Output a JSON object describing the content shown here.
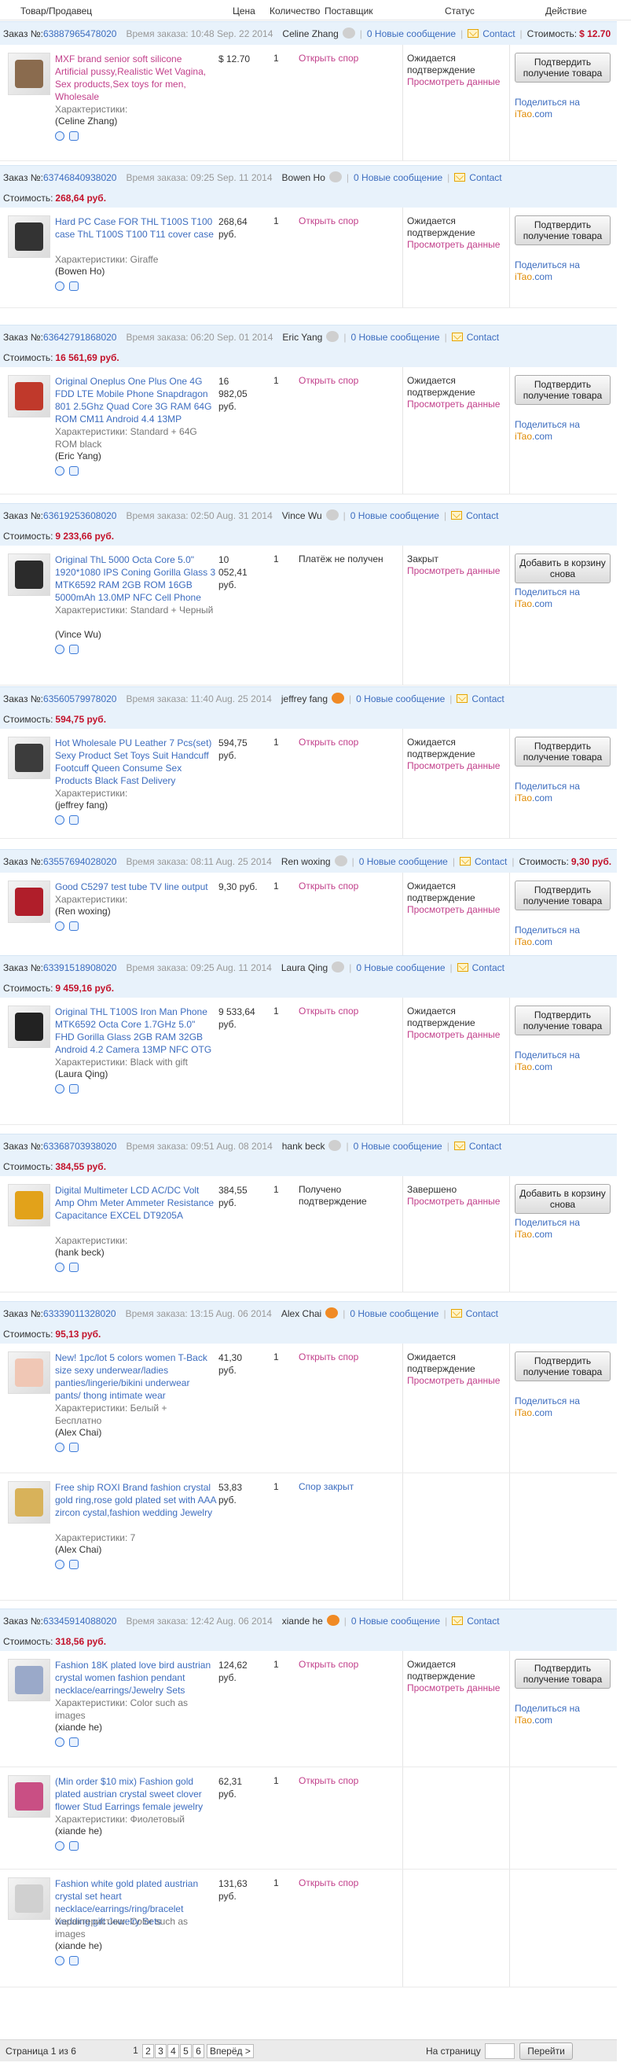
{
  "header": {
    "product_seller": "Товар/Продавец",
    "price": "Цена",
    "quantity": "Количество",
    "supplier": "Поставщик",
    "status": "Статус",
    "action": "Действие"
  },
  "labels": {
    "order_prefix": "Заказ №:",
    "order_time": "Время заказа:",
    "new_messages": "0 Новые сообщение",
    "contact": "Contact",
    "cost": "Стоимость:",
    "characteristics": "Характеристики:",
    "open_dispute": "Открыть спор",
    "share": "Поделиться на",
    "itao": "iTao",
    "itao_com": ".com"
  },
  "orders": [
    {
      "number": "63887965478020",
      "time": "10:48 Sep. 22 2014",
      "seller": "Celine Zhang",
      "cost": "$ 12.70",
      "items": [
        {
          "title": "MXF brand senior soft silicone Artificial pussy,Realistic Wet Vagina, Sex products,Sex toys for men, Wholesale",
          "characteristics": "Характеристики:",
          "seller": "(Celine Zhang)",
          "price": "$ 12.70",
          "qty": "1",
          "dispute": "Открыть спор",
          "status": "Ожидается подтверждение",
          "view": "Просмотреть данные",
          "button": "Подтвердить получение товара"
        }
      ]
    },
    {
      "number": "63746840938020",
      "time": "09:25 Sep. 11 2014",
      "seller": "Bowen Ho",
      "cost": "268,64 руб.",
      "items": [
        {
          "title": "Hard PC Case FOR THL T100S T100 case ThL T100S T100 T11 cover case",
          "characteristics": "Характеристики: Giraffe",
          "seller": "(Bowen Ho)",
          "price": "268,64 руб.",
          "qty": "1",
          "dispute": "Открыть спор",
          "status": "Ожидается подтверждение",
          "view": "Просмотреть данные",
          "button": "Подтвердить получение товара"
        }
      ]
    },
    {
      "number": "63642791868020",
      "time": "06:20 Sep. 01 2014",
      "seller": "Eric Yang",
      "cost": "16 561,69 руб.",
      "items": [
        {
          "title": "Original Oneplus One Plus One 4G FDD LTE Mobile Phone Snapdragon 801 2.5Ghz Quad Core 3G RAM 64G ROM CM11 Android 4.4 13MP",
          "characteristics": "Характеристики: Standard + 64G ROM black",
          "seller": "(Eric Yang)",
          "price": "16 982,05 руб.",
          "qty": "1",
          "dispute": "Открыть спор",
          "status": "Ожидается подтверждение",
          "view": "Просмотреть данные",
          "button": "Подтвердить получение товара"
        }
      ]
    },
    {
      "number": "63619253608020",
      "time": "02:50 Aug. 31 2014",
      "seller": "Vince Wu",
      "cost": "9 233,66 руб.",
      "items": [
        {
          "title": "Original ThL 5000 Octa Core 5.0\" 1920*1080 IPS Coning Gorilla Glass 3 MTK6592 RAM 2GB ROM 16GB 5000mAh 13.0MP NFC Cell Phone",
          "characteristics": "Характеристики: Standard + Черный",
          "seller": "(Vince Wu)",
          "price": "10 052,41 руб.",
          "qty": "1",
          "dispute": "Платёж не получен",
          "status": "Закрыт",
          "view": "Просмотреть данные",
          "button": "Добавить в корзину снова"
        }
      ]
    },
    {
      "number": "63560579978020",
      "time": "11:40 Aug. 25 2014",
      "seller": "jeffrey fang",
      "cost": "594,75 руб.",
      "items": [
        {
          "title": "Hot Wholesale PU Leather 7 Pcs(set) Sexy Product Set Toys Suit Handcuff Footcuff Queen Consume Sex Products Black Fast Delivery",
          "characteristics": "Характеристики:",
          "seller": "(jeffrey fang)",
          "price": "594,75 руб.",
          "qty": "1",
          "dispute": "Открыть спор",
          "status": "Ожидается подтверждение",
          "view": "Просмотреть данные",
          "button": "Подтвердить получение товара"
        }
      ]
    },
    {
      "number": "63557694028020",
      "time": "08:11 Aug. 25 2014",
      "seller": "Ren woxing",
      "cost": "9,30 руб.",
      "items": [
        {
          "title": "Good C5297 test tube TV line output",
          "characteristics": "Характеристики:",
          "seller": "(Ren woxing)",
          "price": "9,30 руб.",
          "qty": "1",
          "dispute": "Открыть спор",
          "status": "Ожидается подтверждение",
          "view": "Просмотреть данные",
          "button": "Подтвердить получение товара"
        }
      ]
    },
    {
      "number": "63391518908020",
      "time": "09:25 Aug. 11 2014",
      "seller": "Laura Qing",
      "cost": "9 459,16 руб.",
      "items": [
        {
          "title": "Original THL T100S Iron Man Phone MTK6592 Octa Core 1.7GHz 5.0\" FHD Gorilla Glass 2GB RAM 32GB Android 4.2 Camera 13MP NFC OTG",
          "characteristics": "Характеристики: Black with gift",
          "seller": "(Laura Qing)",
          "price": "9 533,64 руб.",
          "qty": "1",
          "dispute": "Открыть спор",
          "status": "Ожидается подтверждение",
          "view": "Просмотреть данные",
          "button": "Подтвердить получение товара"
        }
      ]
    },
    {
      "number": "63368703938020",
      "time": "09:51 Aug. 08 2014",
      "seller": "hank beck",
      "cost": "384,55 руб.",
      "items": [
        {
          "title": "Digital Multimeter LCD AC/DC Volt Amp Ohm Meter Ammeter Resistance Capacitance EXCEL DT9205A",
          "characteristics": "Характеристики:",
          "seller": "(hank beck)",
          "price": "384,55 руб.",
          "qty": "1",
          "dispute": "Получено подтверждение",
          "status": "Завершено",
          "view": "Просмотреть данные",
          "button": "Добавить в корзину снова"
        }
      ]
    },
    {
      "number": "63339011328020",
      "time": "13:15 Aug. 06 2014",
      "seller": "Alex Chai",
      "cost": "95,13 руб.",
      "items": [
        {
          "title": "New! 1pc/lot 5 colors women T-Back size sexy underwear/ladies panties/lingerie/bikini underwear pants/ thong intimate wear",
          "characteristics": "Характеристики: Белый + Бесплатно",
          "seller": "(Alex Chai)",
          "price": "41,30 руб.",
          "qty": "1",
          "dispute": "Открыть спор",
          "status": "Ожидается подтверждение",
          "view": "Просмотреть данные",
          "button": "Подтвердить получение товара"
        },
        {
          "title": "Free ship ROXI Brand fashion crystal gold ring,rose gold plated set with AAA zircon cystal,fashion wedding Jewelry",
          "characteristics": "Характеристики: 7",
          "seller": "(Alex Chai)",
          "price": "53,83 руб.",
          "qty": "1",
          "dispute": "Спор закрыт"
        }
      ]
    },
    {
      "number": "63345914088020",
      "time": "12:42 Aug. 06 2014",
      "seller": "xiande he",
      "cost": "318,56 руб.",
      "items": [
        {
          "title": "Fashion 18K plated love bird austrian crystal women fashion pendant necklace/earrings/Jewelry Sets",
          "characteristics": "Характеристики: Color such as images",
          "seller": "(xiande he)",
          "price": "124,62 руб.",
          "qty": "1",
          "dispute": "Открыть спор",
          "status": "Ожидается подтверждение",
          "view": "Просмотреть данные",
          "button": "Подтвердить получение товара"
        },
        {
          "title": "(Min order $10 mix) Fashion gold plated austrian crystal sweet clover flower Stud Earrings female jewelry",
          "characteristics": "Характеристики: Фиолетовый",
          "seller": "(xiande he)",
          "price": "62,31 руб.",
          "qty": "1",
          "dispute": "Открыть спор"
        },
        {
          "title": "Fashion white gold plated austrian crystal set heart necklace/earrings/ring/bracelet wedding gift Jewelry Sets",
          "characteristics": "Характеристики: Color such as images",
          "seller": "(xiande he)",
          "price": "131,63 руб.",
          "qty": "1",
          "dispute": "Открыть спор"
        }
      ]
    }
  ],
  "pager": {
    "summary": "Страница 1 из 6",
    "pages": [
      "1",
      "2",
      "3",
      "4",
      "5",
      "6"
    ],
    "next": "Вперёд >",
    "goto_label": "На страницу",
    "go_button": "Перейти"
  }
}
